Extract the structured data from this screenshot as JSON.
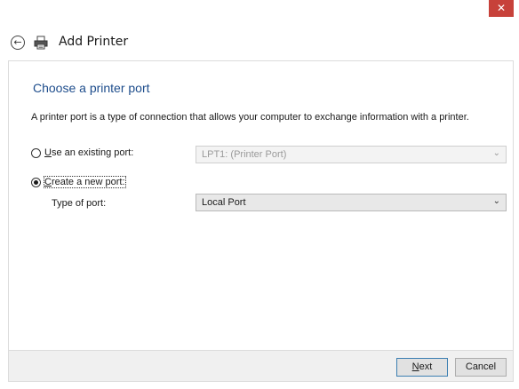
{
  "window": {
    "close_label": "",
    "title": "Add Printer"
  },
  "page": {
    "heading": "Choose a printer port",
    "description": "A printer port is a type of connection that allows your computer to exchange information with a printer."
  },
  "options": {
    "existing": {
      "label_mnemonic": "U",
      "label_rest": "se an existing port:",
      "selected": false,
      "value": "LPT1: (Printer Port)"
    },
    "create": {
      "label_mnemonic": "C",
      "label_rest": "reate a new port:",
      "selected": true,
      "type_label": "Type of port:",
      "type_value": "Local Port"
    }
  },
  "footer": {
    "next_mnemonic": "N",
    "next_rest": "ext",
    "cancel_label": "Cancel"
  },
  "icons": {
    "close": "close-icon",
    "back": "back-arrow-icon",
    "printer": "printer-icon",
    "dropdown": "chevron-down-icon"
  },
  "colors": {
    "close_bg": "#c7413a",
    "heading": "#1e4d8c",
    "primary_border": "#3c7fb1"
  }
}
